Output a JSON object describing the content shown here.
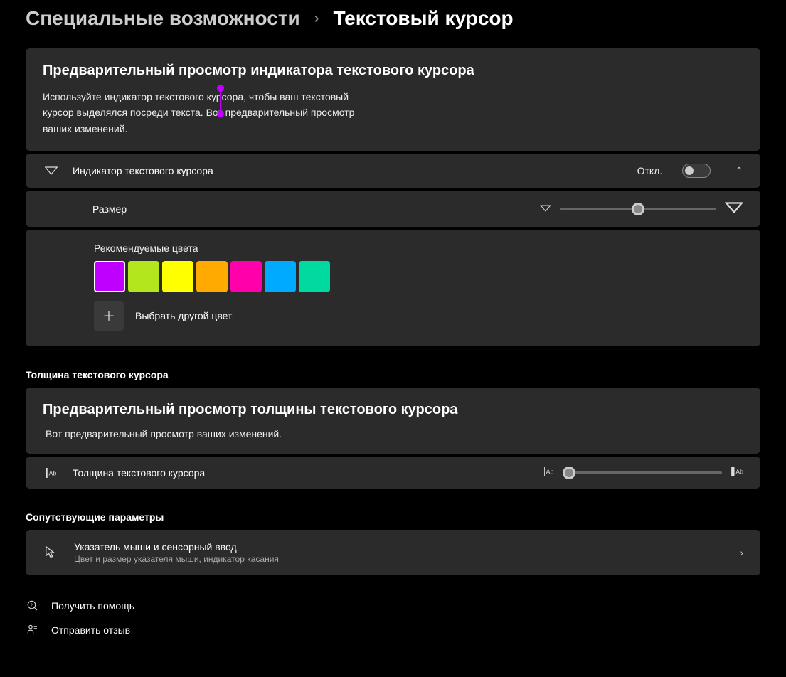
{
  "breadcrumb": {
    "parent": "Специальные возможности",
    "current": "Текстовый курсор"
  },
  "preview_indicator": {
    "title": "Предварительный просмотр индикатора текстового курсора",
    "body": "Используйте индикатор текстового курсора, чтобы ваш текстовый курсор выделялся посреди текста. Вот предварительный просмотр ваших изменений."
  },
  "indicator_toggle": {
    "label": "Индикатор текстового курсора",
    "state_label": "Откл.",
    "on": false
  },
  "size": {
    "label": "Размер",
    "value": 50
  },
  "colors": {
    "label": "Рекомендуемые цвета",
    "swatches": [
      {
        "hex": "#c000ff",
        "selected": true
      },
      {
        "hex": "#b4e61e",
        "selected": false
      },
      {
        "hex": "#ffff00",
        "selected": false
      },
      {
        "hex": "#ffaa00",
        "selected": false
      },
      {
        "hex": "#ff00aa",
        "selected": false
      },
      {
        "hex": "#00aaff",
        "selected": false
      },
      {
        "hex": "#00d9a0",
        "selected": false
      }
    ],
    "another_label": "Выбрать другой цвет"
  },
  "thickness": {
    "heading": "Толщина текстового курсора",
    "preview_title": "Предварительный просмотр толщины текстового курсора",
    "preview_body": "Вот предварительный просмотр ваших изменений.",
    "row_label": "Толщина текстового курсора",
    "value": 1
  },
  "related": {
    "heading": "Сопутствующие параметры",
    "item": {
      "title": "Указатель мыши и сенсорный ввод",
      "subtitle": "Цвет и размер указателя мыши, индикатор касания"
    }
  },
  "links": {
    "help": "Получить помощь",
    "feedback": "Отправить отзыв"
  }
}
